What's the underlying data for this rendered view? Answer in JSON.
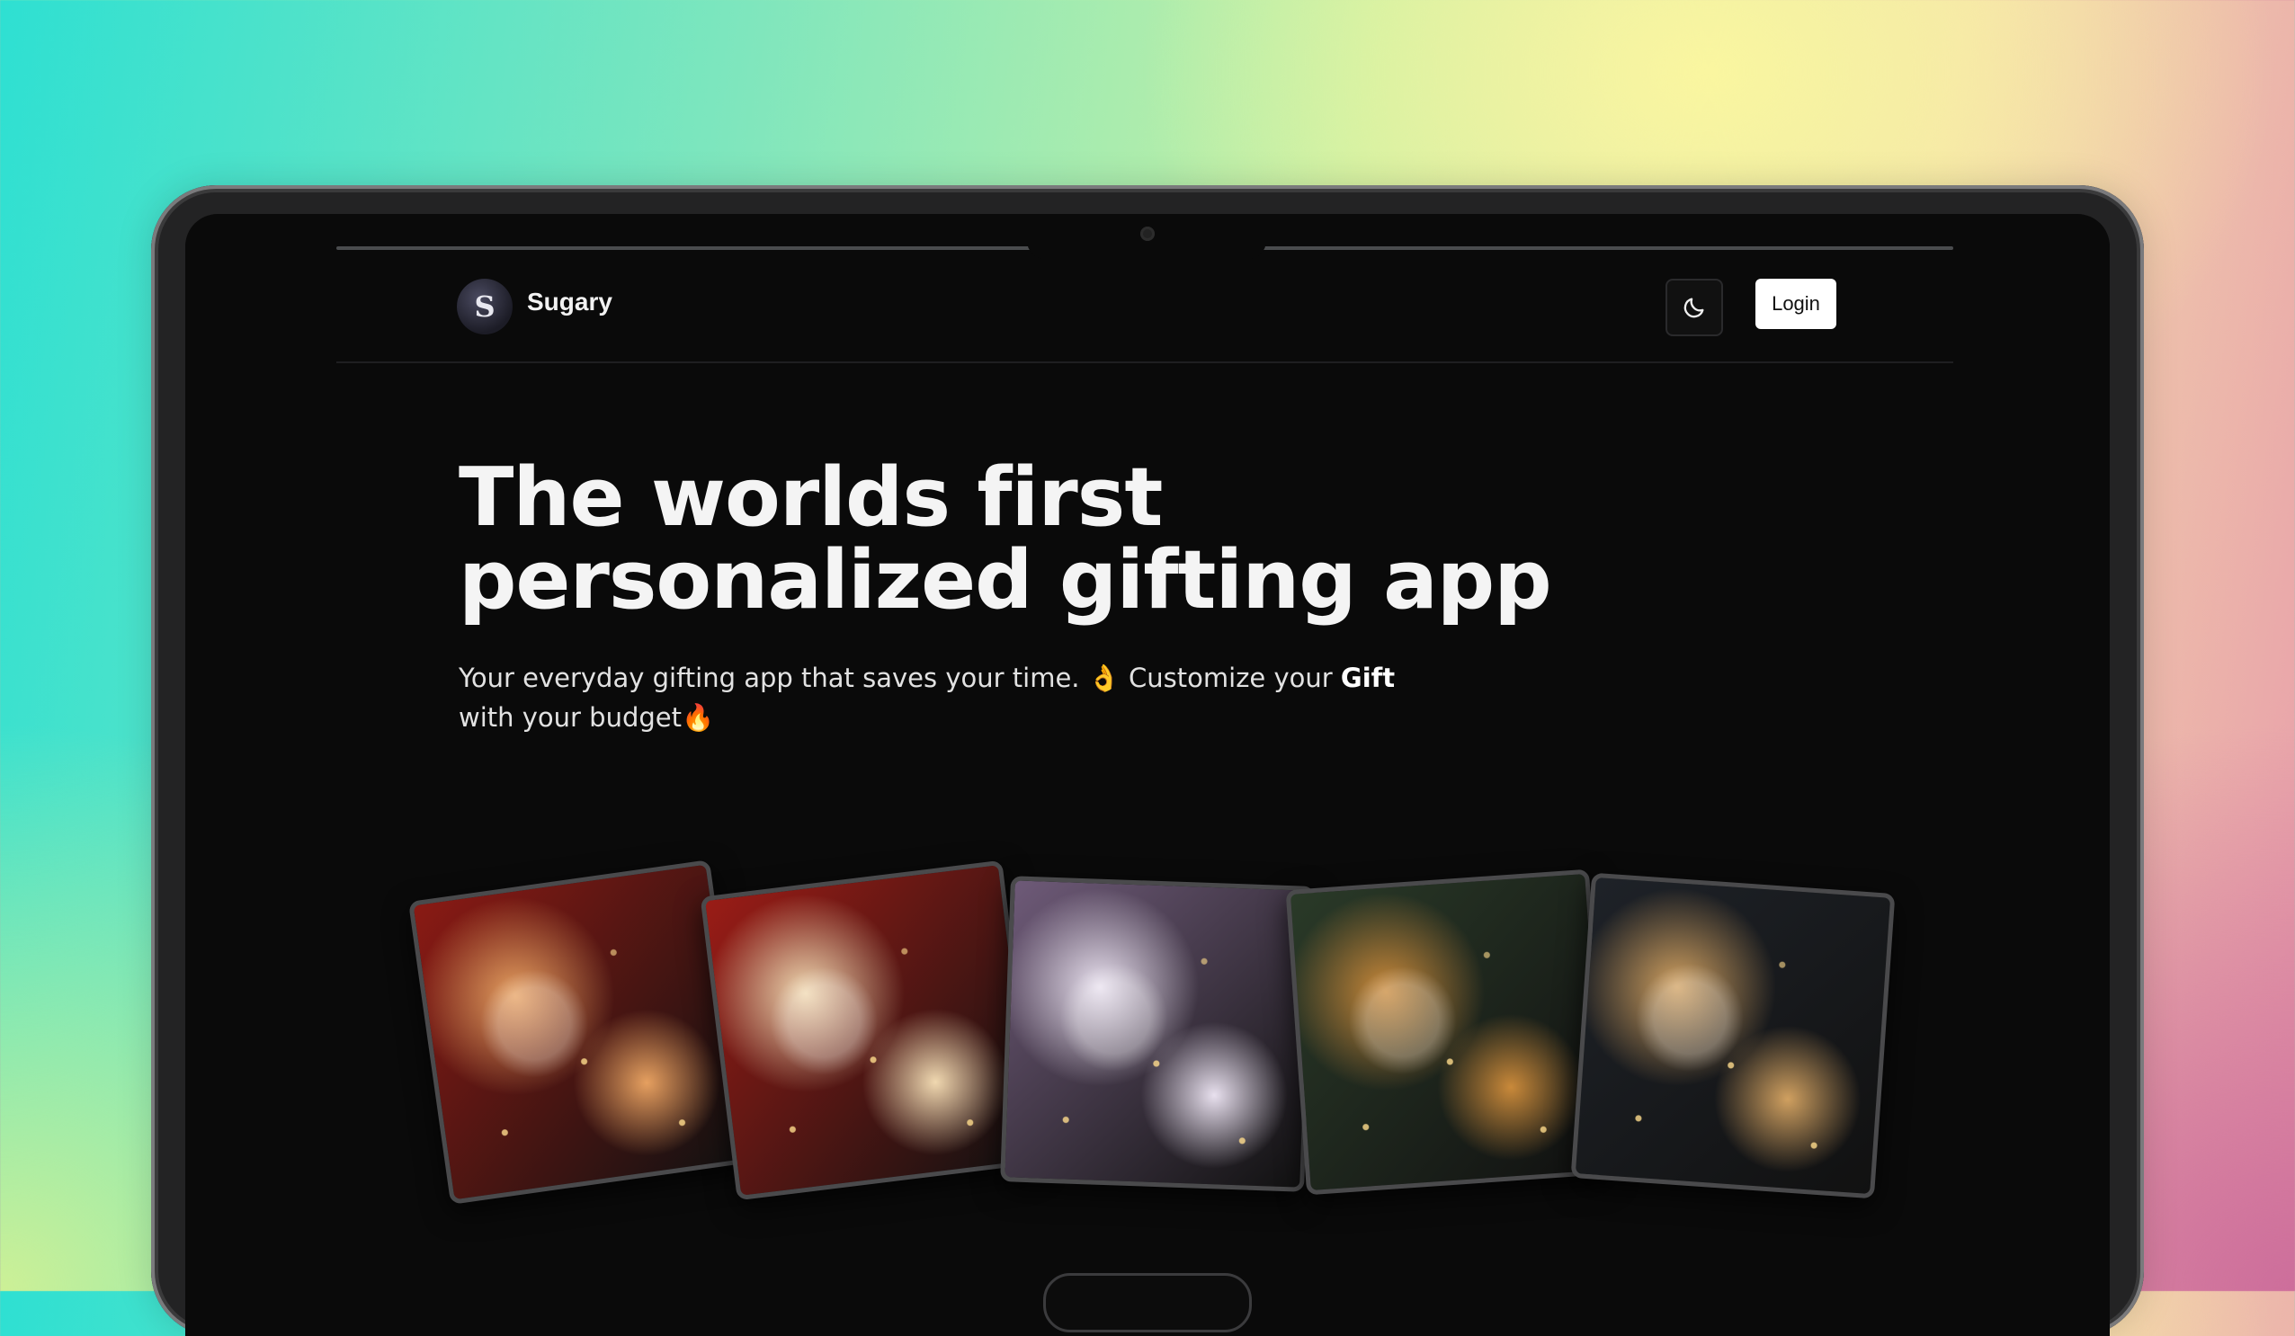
{
  "brand": {
    "name": "Sugary",
    "logo_letter": "S"
  },
  "nav": {
    "login_label": "Login",
    "theme_toggle_icon": "moon-icon"
  },
  "hero": {
    "title_line1": "The worlds first",
    "title_line2": "personalized gifting app",
    "subtitle_part1": "Your everyday gifting app that saves your time. 👌 Customize your ",
    "subtitle_bold": "Gift",
    "subtitle_part2": " with your budget🔥"
  },
  "gallery": {
    "images": [
      {
        "name": "gift-box-red-festive",
        "main_color": "#8a1a14",
        "accent": "#e6a060"
      },
      {
        "name": "gift-box-red-flowers",
        "main_color": "#9a1c16",
        "accent": "#f0d8b0"
      },
      {
        "name": "gift-box-starbucks-purple",
        "main_color": "#6e5a78",
        "accent": "#e8e0ee"
      },
      {
        "name": "gift-basket-green-ribbon",
        "main_color": "#2a3a28",
        "accent": "#c9893a"
      },
      {
        "name": "gift-box-eid-dark",
        "main_color": "#1e2228",
        "accent": "#d0a060"
      }
    ]
  }
}
